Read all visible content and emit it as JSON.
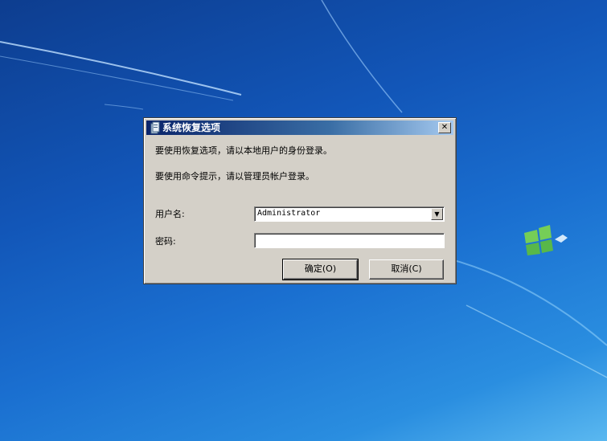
{
  "dialog": {
    "title": "系统恢复选项",
    "close_glyph": "✕",
    "message_1": "要使用恢复选项，请以本地用户的身份登录。",
    "message_2": "要使用命令提示，请以管理员帐户登录。",
    "username_label": "用户名:",
    "username_value": "Administrator",
    "dropdown_glyph": "▼",
    "password_label": "密码:",
    "password_value": "",
    "ok_label": "确定(O)",
    "cancel_label": "取消(C)"
  },
  "icons": {
    "title": "system-recovery-icon",
    "close": "close-icon",
    "dropdown": "chevron-down-icon",
    "wallpaper_logo": "windows-logo-icon"
  },
  "colors": {
    "desktop_gradient_start": "#0d3d8f",
    "desktop_gradient_end": "#5ab8f0",
    "dialog_face": "#d4d0c8",
    "titlebar_start": "#0a246a",
    "titlebar_end": "#a6caf0"
  }
}
